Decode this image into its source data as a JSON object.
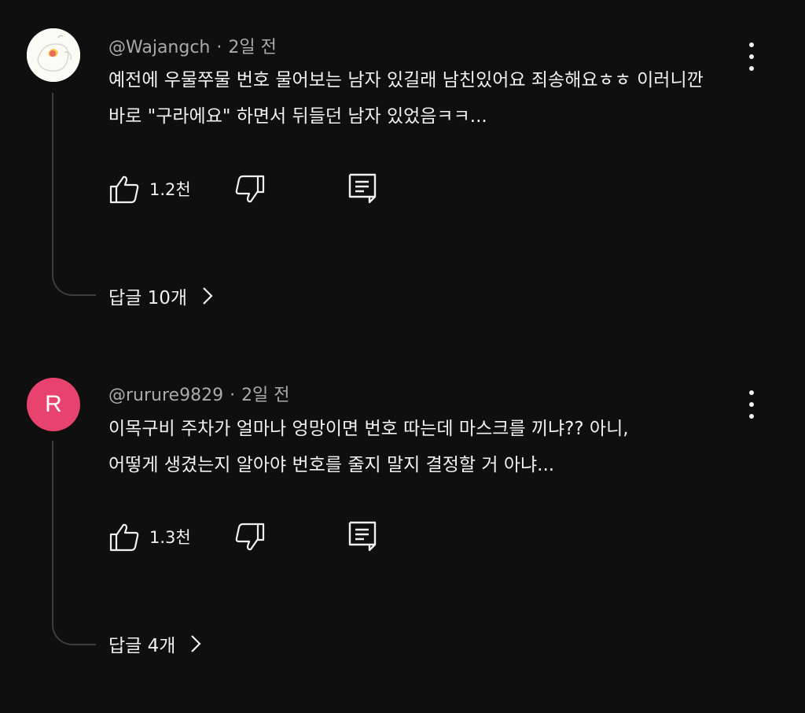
{
  "comments": [
    {
      "author": "@Wajangch",
      "time": "2일 전",
      "text_line1": "예전에 우물쭈물 번호 물어보는 남자 있길래 남친있어요 죄송해요ㅎㅎ 이러니깐",
      "text_line2": "바로 \"구라에요\" 하면서 뒤들던 남자 있었음ㅋㅋ...",
      "likes": "1.2천",
      "replies_label": "답글 10개",
      "avatar": "avatar-image"
    },
    {
      "author": "@rurure9829",
      "time": "2일 전",
      "text_line1": "이목구비 주차가 얼마나 엉망이면 번호 따는데 마스크를 끼냐?? 아니,",
      "text_line2": "어떻게 생겼는지 알아야 번호를 줄지 말지 결정할 거 아냐...",
      "likes": "1.3천",
      "replies_label": "답글 4개",
      "avatar_letter": "R",
      "avatar_color": "#e8436e"
    }
  ],
  "icons": {
    "like": "thumbs-up-icon",
    "dislike": "thumbs-down-icon",
    "reply": "comment-icon",
    "more": "more-vertical-icon",
    "expand": "chevron-right-icon"
  }
}
